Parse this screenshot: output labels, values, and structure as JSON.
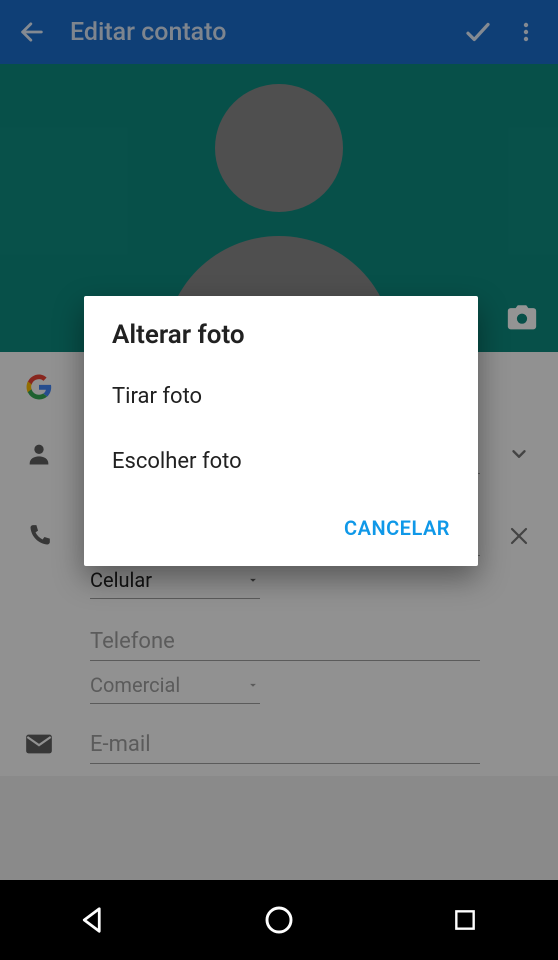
{
  "header": {
    "title": "Editar contato"
  },
  "form": {
    "phone": {
      "type_selected": "Celular",
      "second_placeholder": "Telefone",
      "second_type": "Comercial"
    },
    "email": {
      "placeholder": "E-mail"
    }
  },
  "dialog": {
    "title": "Alterar foto",
    "option_take": "Tirar foto",
    "option_choose": "Escolher foto",
    "cancel": "CANCELAR"
  }
}
